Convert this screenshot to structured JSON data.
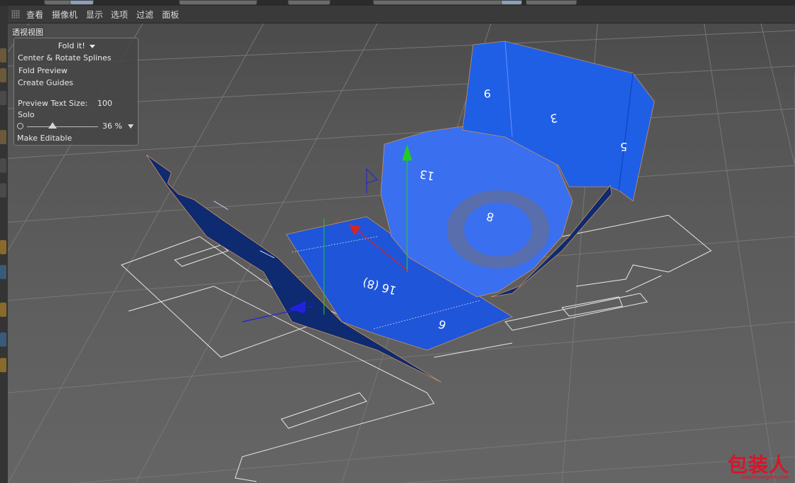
{
  "menu": {
    "items": [
      "查看",
      "摄像机",
      "显示",
      "选项",
      "过滤",
      "面板"
    ]
  },
  "viewport": {
    "label": "透视视图"
  },
  "fold_panel": {
    "title": "Fold it!",
    "items": [
      "Center & Rotate Splines",
      "Fold Preview",
      "Create Guides"
    ],
    "preview_text_size_label": "Preview Text Size:",
    "preview_text_size_value": "100",
    "solo_label": "Solo",
    "slider_value_text": "36 %",
    "slider_fraction": 0.36,
    "make_editable_label": "Make Editable"
  },
  "model_labels": {
    "lid": "9",
    "top_panel": "3",
    "side_flap": "5",
    "tab": "13",
    "hole": "8",
    "center": "16 (8)",
    "front": "6"
  },
  "watermark": {
    "text": "包装人",
    "sub": "baozhuangren.com"
  },
  "colors": {
    "box_blue": "#1e5fe6",
    "box_dark": "#0e2a70",
    "axis_green": "#22cc22",
    "axis_red": "#dd2222",
    "axis_blue": "#2222dd",
    "watermark": "#d8152b"
  }
}
